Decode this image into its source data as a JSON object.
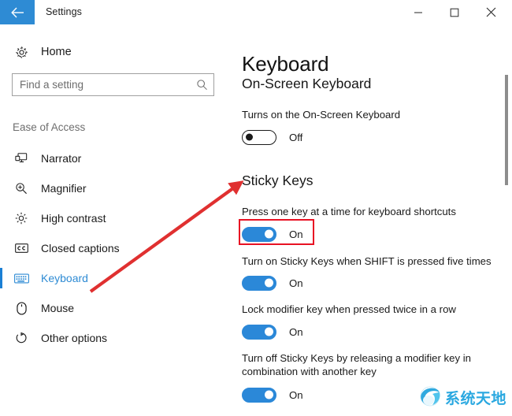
{
  "window": {
    "title": "Settings",
    "back_icon": "back-arrow-icon",
    "controls": {
      "minimize": "minimize-icon",
      "maximize": "maximize-icon",
      "close": "close-icon"
    },
    "accent_color": "#2e8bd4"
  },
  "sidebar": {
    "home_label": "Home",
    "home_icon": "gear-icon",
    "search": {
      "placeholder": "Find a setting",
      "value": "",
      "icon": "search-icon"
    },
    "group_title": "Ease of Access",
    "items": [
      {
        "label": "Narrator",
        "icon": "narrator-icon",
        "selected": false
      },
      {
        "label": "Magnifier",
        "icon": "magnifier-icon",
        "selected": false
      },
      {
        "label": "High contrast",
        "icon": "high-contrast-icon",
        "selected": false
      },
      {
        "label": "Closed captions",
        "icon": "closed-captions-icon",
        "selected": false
      },
      {
        "label": "Keyboard",
        "icon": "keyboard-icon",
        "selected": true
      },
      {
        "label": "Mouse",
        "icon": "mouse-icon",
        "selected": false
      },
      {
        "label": "Other options",
        "icon": "other-options-icon",
        "selected": false
      }
    ],
    "selected_color": "#2e8bd4"
  },
  "main": {
    "page_title": "Keyboard",
    "sections": [
      {
        "heading": "On-Screen Keyboard",
        "settings": [
          {
            "label": "Turns on the On-Screen Keyboard",
            "state": "Off",
            "on": false
          }
        ]
      },
      {
        "heading": "Sticky Keys",
        "settings": [
          {
            "label": "Press one key at a time for keyboard shortcuts",
            "state": "On",
            "on": true,
            "highlighted": true
          },
          {
            "label": "Turn on Sticky Keys when SHIFT is pressed five times",
            "state": "On",
            "on": true
          },
          {
            "label": "Lock modifier key when pressed twice in a row",
            "state": "On",
            "on": true
          },
          {
            "label": "Turn off Sticky Keys by releasing a modifier key in combination with another key",
            "state": "On",
            "on": true
          }
        ]
      }
    ],
    "toggle_on_color": "#2b88d8"
  },
  "annotations": {
    "highlight_color": "#e81123",
    "arrow_color": "#e03030",
    "arrow_from": "sidebar-keyboard-area",
    "arrow_to": "Sticky Keys"
  },
  "watermark": {
    "text": "系统天地",
    "color": "#2aa8e0",
    "logo_icon": "globe-logo-icon"
  }
}
